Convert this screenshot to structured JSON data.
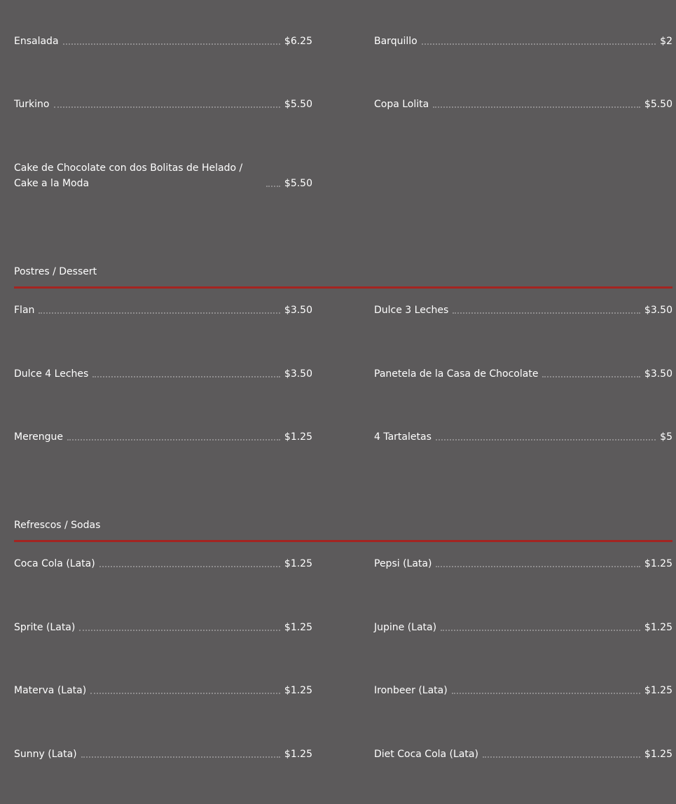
{
  "top": {
    "items": [
      {
        "name": "Ensalada",
        "price": "$6.25"
      },
      {
        "name": "Barquillo",
        "price": "$2"
      },
      {
        "name": "Turkino",
        "price": "$5.50"
      },
      {
        "name": "Copa Lolita",
        "price": "$5.50"
      },
      {
        "name": "Cake de Chocolate con dos Bolitas de Helado / Cake a la Moda",
        "price": "$5.50"
      }
    ]
  },
  "dessert": {
    "title": "Postres / Dessert",
    "items": [
      {
        "name": "Flan",
        "price": "$3.50"
      },
      {
        "name": "Dulce 3 Leches",
        "price": "$3.50"
      },
      {
        "name": "Dulce 4 Leches",
        "price": "$3.50"
      },
      {
        "name": "Panetela de la Casa de Chocolate",
        "price": "$3.50"
      },
      {
        "name": "Merengue",
        "price": "$1.25"
      },
      {
        "name": "4 Tartaletas",
        "price": "$5"
      }
    ]
  },
  "sodas": {
    "title": "Refrescos / Sodas",
    "items": [
      {
        "name": "Coca Cola (Lata)",
        "price": "$1.25"
      },
      {
        "name": "Pepsi (Lata)",
        "price": "$1.25"
      },
      {
        "name": "Sprite (Lata)",
        "price": "$1.25"
      },
      {
        "name": "Jupine (Lata)",
        "price": "$1.25"
      },
      {
        "name": "Materva (Lata)",
        "price": "$1.25"
      },
      {
        "name": "Ironbeer (Lata)",
        "price": "$1.25"
      },
      {
        "name": "Sunny (Lata)",
        "price": "$1.25"
      },
      {
        "name": "Diet Coca Cola (Lata)",
        "price": "$1.25"
      }
    ]
  },
  "colors": {
    "background": "#5c5a5b",
    "text": "#ffffff",
    "divider": "#a42421",
    "dots": "#8f8d8e"
  }
}
